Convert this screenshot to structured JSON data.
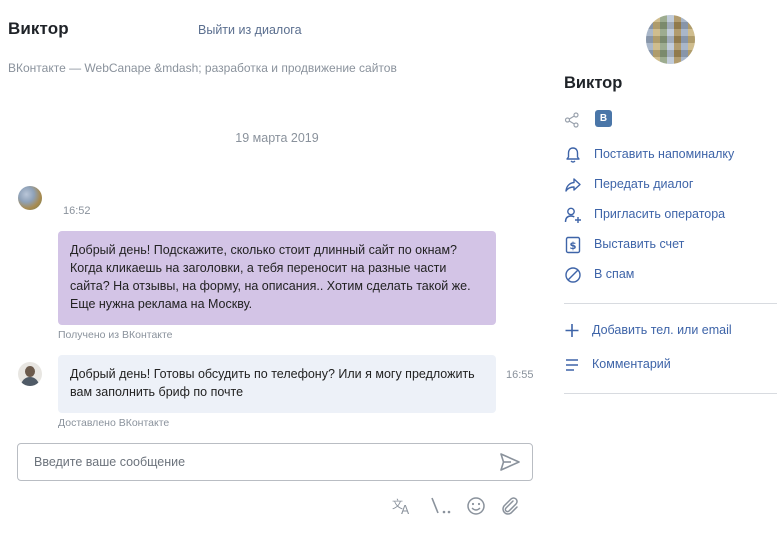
{
  "header": {
    "contact_name": "Виктор",
    "exit_label": "Выйти из диалога",
    "subtitle": "ВКонтакте — WebCanape &mdash; разработка и продвижение сайтов"
  },
  "chat": {
    "date_separator": "19 марта 2019",
    "messages": [
      {
        "time": "16:52",
        "text": "Добрый день! Подскажите, сколько стоит длинный сайт по окнам? Когда кликаешь на заголовки, а тебя переносит на разные части сайта? На отзывы, на форму, на описания.. Хотим сделать такой же. Еще нужна реклама на Москву.",
        "status": "Получено из ВКонтакте"
      },
      {
        "time": "16:55",
        "text": "Добрый день! Готовы обсудить по телефону? Или я могу предложить вам заполнить бриф по почте",
        "status": "Доставлено ВКонтакте"
      }
    ]
  },
  "composer": {
    "placeholder": "Введите ваше сообщение",
    "value": ""
  },
  "sidebar": {
    "name": "Виктор",
    "vk_badge": "В",
    "actions": [
      {
        "label": "Поставить напоминалку",
        "icon": "bell-icon"
      },
      {
        "label": "Передать диалог",
        "icon": "forward-arrow-icon"
      },
      {
        "label": "Пригласить оператора",
        "icon": "add-user-icon"
      },
      {
        "label": "Выставить счет",
        "icon": "invoice-dollar-icon"
      },
      {
        "label": "В спам",
        "icon": "block-icon"
      }
    ],
    "extra_actions": [
      {
        "label": "Добавить тел. или email",
        "icon": "plus-icon"
      },
      {
        "label": "Комментарий",
        "icon": "comment-lines-icon"
      }
    ]
  },
  "colors": {
    "incoming_bubble": "#d3c4e6",
    "outgoing_bubble": "#edf1f8",
    "link": "#3e64a8",
    "vk_brand": "#4a76a8"
  }
}
